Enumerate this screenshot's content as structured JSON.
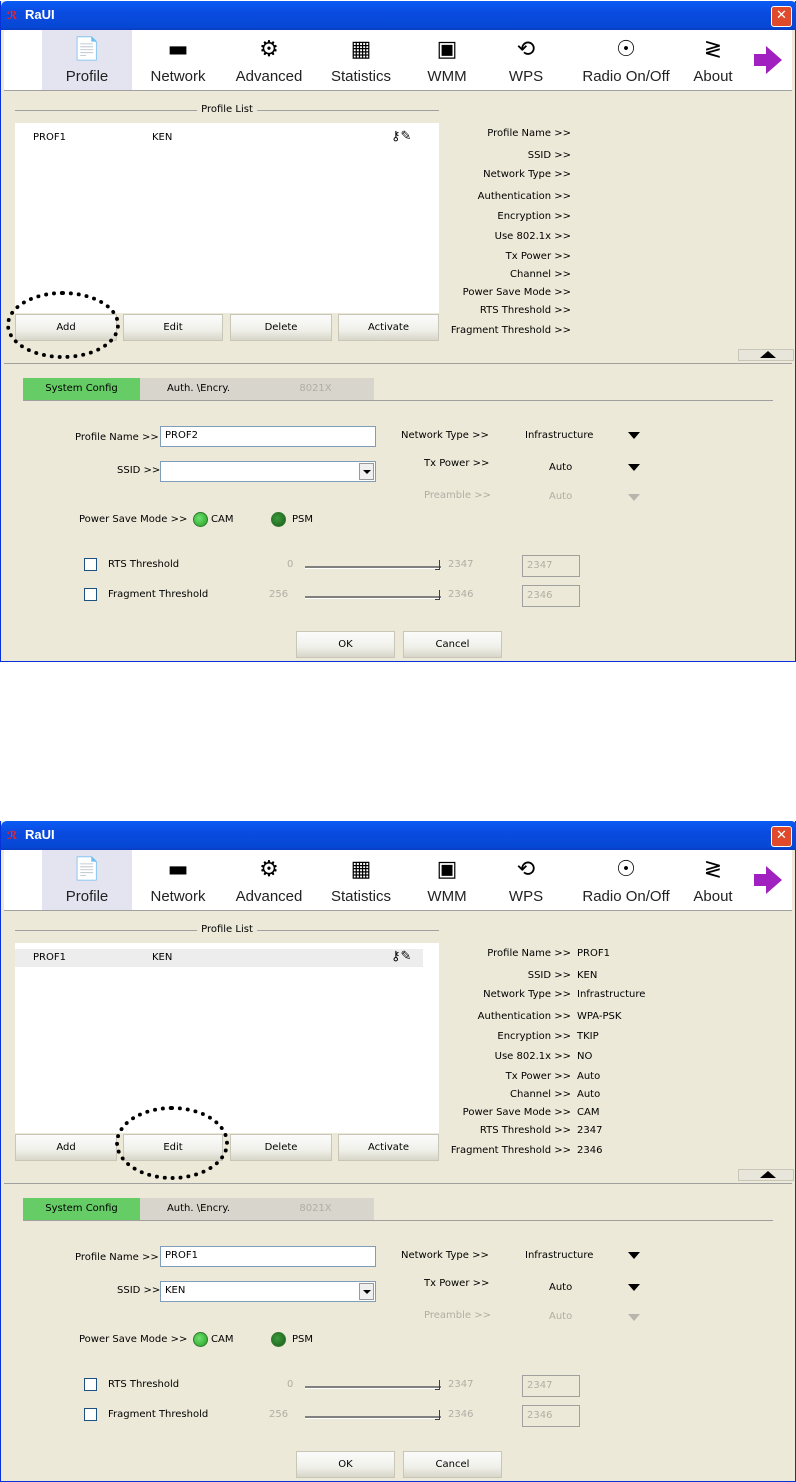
{
  "screens": [
    {
      "title": "RaUI",
      "toolbar": [
        {
          "label": "Profile",
          "icon": "profile-icon"
        },
        {
          "label": "Network",
          "icon": "network-icon"
        },
        {
          "label": "Advanced",
          "icon": "advanced-icon"
        },
        {
          "label": "Statistics",
          "icon": "statistics-icon"
        },
        {
          "label": "WMM",
          "icon": "wmm-icon"
        },
        {
          "label": "WPS",
          "icon": "wps-icon"
        },
        {
          "label": "Radio On/Off",
          "icon": "radio-icon"
        },
        {
          "label": "About",
          "icon": "about-icon"
        }
      ],
      "profile_list": {
        "title": "Profile List",
        "rows": [
          {
            "name": "PROF1",
            "ssid": "KEN"
          }
        ]
      },
      "buttons": {
        "add": "Add",
        "edit": "Edit",
        "delete": "Delete",
        "activate": "Activate"
      },
      "info": {
        "labels": [
          "Profile Name >>",
          "SSID >>",
          "Network Type >>",
          "Authentication >>",
          "Encryption >>",
          "Use 802.1x >>",
          "Tx Power >>",
          "Channel >>",
          "Power Save Mode >>",
          "RTS Threshold >>",
          "Fragment Threshold >>"
        ],
        "values": [
          "",
          "",
          "",
          "",
          "",
          "",
          "",
          "",
          "",
          "",
          ""
        ]
      },
      "tabs": [
        "System Config",
        "Auth. \\Encry.",
        "8021X"
      ],
      "form": {
        "profile_name_label": "Profile Name >>",
        "profile_name": "PROF2",
        "ssid_label": "SSID >>",
        "ssid": "",
        "network_type_label": "Network Type >>",
        "network_type": "Infrastructure",
        "tx_power_label": "Tx Power >>",
        "tx_power": "Auto",
        "preamble_label": "Preamble >>",
        "preamble": "Auto",
        "psm_label": "Power Save Mode >>",
        "cam": "CAM",
        "psm": "PSM",
        "rts_label": "RTS Threshold",
        "rts_min": "0",
        "rts_max": "2347",
        "rts_value": "2347",
        "frag_label": "Fragment Threshold",
        "frag_min": "256",
        "frag_max": "2346",
        "frag_value": "2346",
        "ok": "OK",
        "cancel": "Cancel"
      },
      "highlight": "add"
    },
    {
      "title": "RaUI",
      "toolbar": [
        {
          "label": "Profile",
          "icon": "profile-icon"
        },
        {
          "label": "Network",
          "icon": "network-icon"
        },
        {
          "label": "Advanced",
          "icon": "advanced-icon"
        },
        {
          "label": "Statistics",
          "icon": "statistics-icon"
        },
        {
          "label": "WMM",
          "icon": "wmm-icon"
        },
        {
          "label": "WPS",
          "icon": "wps-icon"
        },
        {
          "label": "Radio On/Off",
          "icon": "radio-icon"
        },
        {
          "label": "About",
          "icon": "about-icon"
        }
      ],
      "profile_list": {
        "title": "Profile List",
        "rows": [
          {
            "name": "PROF1",
            "ssid": "KEN"
          }
        ]
      },
      "buttons": {
        "add": "Add",
        "edit": "Edit",
        "delete": "Delete",
        "activate": "Activate"
      },
      "info": {
        "labels": [
          "Profile Name >>",
          "SSID >>",
          "Network Type >>",
          "Authentication >>",
          "Encryption >>",
          "Use 802.1x >>",
          "Tx Power >>",
          "Channel >>",
          "Power Save Mode >>",
          "RTS Threshold >>",
          "Fragment Threshold >>"
        ],
        "values": [
          "PROF1",
          "KEN",
          "Infrastructure",
          "WPA-PSK",
          "TKIP",
          "NO",
          "Auto",
          "Auto",
          "CAM",
          "2347",
          "2346"
        ]
      },
      "tabs": [
        "System Config",
        "Auth. \\Encry.",
        "8021X"
      ],
      "form": {
        "profile_name_label": "Profile Name >>",
        "profile_name": "PROF1",
        "ssid_label": "SSID >>",
        "ssid": "KEN",
        "network_type_label": "Network Type >>",
        "network_type": "Infrastructure",
        "tx_power_label": "Tx Power >>",
        "tx_power": "Auto",
        "preamble_label": "Preamble >>",
        "preamble": "Auto",
        "psm_label": "Power Save Mode >>",
        "cam": "CAM",
        "psm": "PSM",
        "rts_label": "RTS Threshold",
        "rts_min": "0",
        "rts_max": "2347",
        "rts_value": "2347",
        "frag_label": "Fragment Threshold",
        "frag_min": "256",
        "frag_max": "2346",
        "frag_value": "2346",
        "ok": "OK",
        "cancel": "Cancel"
      },
      "highlight": "edit"
    }
  ],
  "icon_glyphs": {
    "profile-icon": "📄",
    "network-icon": "▬",
    "advanced-icon": "⚙",
    "statistics-icon": "▦",
    "wmm-icon": "▣",
    "wps-icon": "⟲",
    "radio-icon": "☉",
    "about-icon": "≷"
  }
}
